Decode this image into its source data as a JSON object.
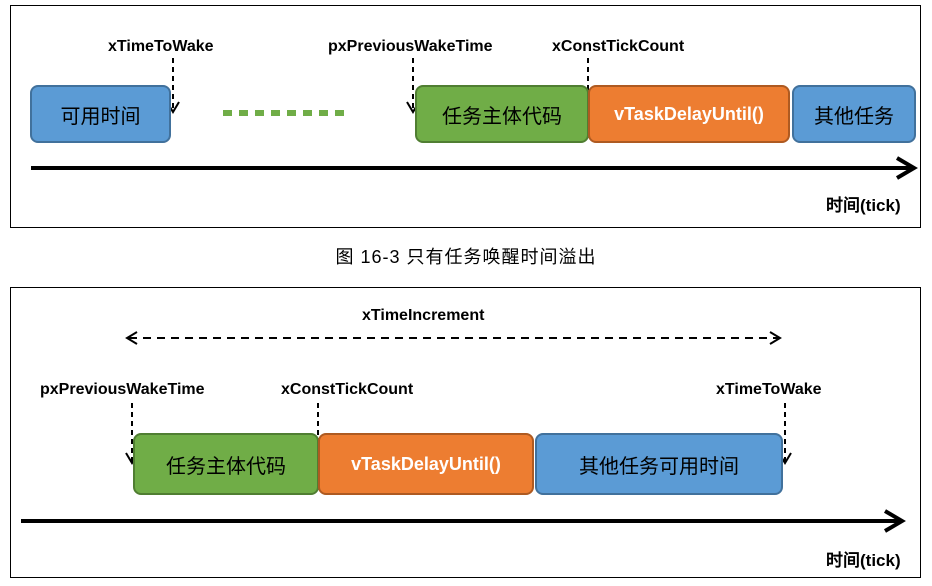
{
  "top_panel": {
    "labels": {
      "time_to_wake": "xTimeToWake",
      "previous_wake_time": "pxPreviousWakeTime",
      "const_tick_count": "xConstTickCount"
    },
    "boxes": {
      "available_time": "可用时间",
      "task_body": "任务主体代码",
      "delay_until": "vTaskDelayUntil()",
      "other_tasks": "其他任务"
    },
    "axis_label": "时间(tick)"
  },
  "caption": "图 16-3 只有任务唤醒时间溢出",
  "bottom_panel": {
    "labels": {
      "time_increment": "xTimeIncrement",
      "previous_wake_time": "pxPreviousWakeTime",
      "const_tick_count": "xConstTickCount",
      "time_to_wake": "xTimeToWake"
    },
    "boxes": {
      "task_body": "任务主体代码",
      "delay_until": "vTaskDelayUntil()",
      "other_tasks_available": "其他任务可用时间"
    },
    "axis_label": "时间(tick)"
  },
  "colors": {
    "blue": "#5B9BD5",
    "green": "#70AD47",
    "orange": "#ED7D31",
    "line": "#000000"
  }
}
